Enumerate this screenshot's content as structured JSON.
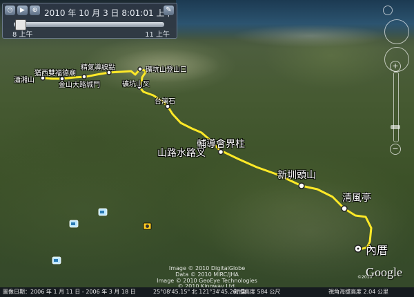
{
  "time_slider": {
    "datetime": "2010 年 10 月 3 日  8:01:01 上午",
    "start_label": "8 上午",
    "end_label": "11 上午"
  },
  "trail_labels": [
    {
      "name": "label-sianjhen-mountain",
      "text": "瀟湘山",
      "size": "s"
    },
    {
      "name": "label-shuangxi-fudemiao",
      "text": "猶西雙福德廟",
      "size": "s"
    },
    {
      "name": "label-jingjia-dao-point",
      "text": "精氣導線點",
      "size": "s"
    },
    {
      "name": "label-nanzhuang-road-gate",
      "text": "金山大路城門",
      "size": "s"
    },
    {
      "name": "label-bitan-mountain-fork",
      "text": "礦坑山登山口",
      "size": "s"
    },
    {
      "name": "label-bitan-fork",
      "text": "礦坑山叉",
      "size": "s"
    },
    {
      "name": "label-taiwan-stone",
      "text": "台灣石",
      "size": "s"
    },
    {
      "name": "label-boundary-marker",
      "text": "輔導會界柱",
      "size": "l"
    },
    {
      "name": "label-road-water-fork",
      "text": "山路水路叉",
      "size": "l"
    },
    {
      "name": "label-xinzhen-touzhan",
      "text": "新圳頭山",
      "size": "l"
    },
    {
      "name": "label-qingfeng-pavilion",
      "text": "清風亭",
      "size": "l"
    },
    {
      "name": "label-neicuo",
      "text": "內厝",
      "size": "xl"
    }
  ],
  "attribution": [
    "Image © 2010 DigitalGlobe",
    "Data © 2010 MIRC/JHA",
    "Image © 2010 GeoEye Technologies",
    "© 2010 Kingway Ltd."
  ],
  "google_logo": "Google",
  "logo_year": "©2010",
  "status_bar": {
    "imagery_date": "圖像日期：2006 年 1 月 11 日 - 2006 年 3 月 18 日",
    "coordinates": "25°08'45.15\" 北 121°34'45.26\" 東",
    "elevation": "海拔高度 584 公尺",
    "eye_alt": "視角海拔高度 2.04 公里"
  },
  "colors": {
    "trail": "#ffe927",
    "waypoint_fill": "#ffffff",
    "waypoint_stroke": "#222222"
  },
  "icons": [
    "camera-icon",
    "cup-icon",
    "cup-icon",
    "cup-icon",
    "play-icon",
    "clock-icon",
    "zoom-icon",
    "wrench-icon",
    "compass-icon",
    "look-joystick-icon",
    "move-joystick-icon",
    "zoom-in-icon",
    "zoom-out-icon"
  ]
}
